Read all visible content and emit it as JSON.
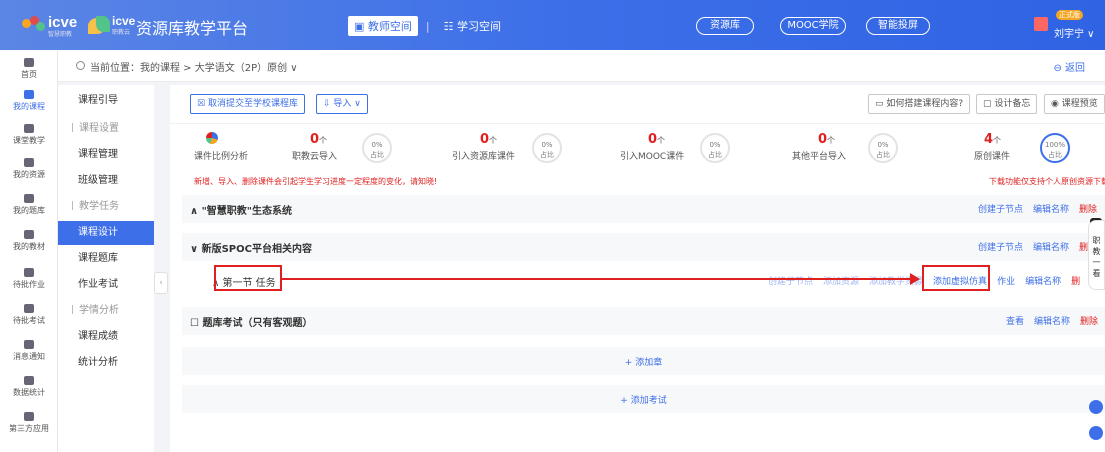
{
  "header": {
    "logo1": {
      "text": "icve",
      "sub": "智慧职教"
    },
    "logo2": {
      "text": "icve",
      "sub": "职教云"
    },
    "brand": "资源库教学平台",
    "tabs": [
      {
        "label": "教师空间",
        "active": true
      },
      {
        "label": "学习空间",
        "active": false
      }
    ],
    "pills": [
      "资源库",
      "MOOC学院",
      "智能投屏"
    ],
    "user": {
      "badge": "正式版",
      "name": "刘宇宁"
    }
  },
  "left_nav": [
    {
      "label": "首页",
      "icon": "home-icon"
    },
    {
      "label": "我的课程",
      "icon": "course-icon",
      "active": true
    },
    {
      "label": "课堂教学",
      "icon": "classroom-icon"
    },
    {
      "label": "我的资源",
      "icon": "resource-icon"
    },
    {
      "label": "我的题库",
      "icon": "question-bank-icon"
    },
    {
      "label": "我的教材",
      "icon": "textbook-icon"
    },
    {
      "label": "待批作业",
      "icon": "homework-icon"
    },
    {
      "label": "待批考试",
      "icon": "exam-icon"
    },
    {
      "label": "消息通知",
      "icon": "message-icon"
    },
    {
      "label": "数据统计",
      "icon": "statistics-icon"
    },
    {
      "label": "第三方应用",
      "icon": "apps-icon"
    }
  ],
  "breadcrumb": {
    "text": "当前位置：我的课程 > 大学语文（2P）原创 ∨",
    "back": "返回"
  },
  "side_nav": [
    {
      "label": "课程引导"
    },
    {
      "label": "课程设置",
      "group": true
    },
    {
      "label": "课程管理"
    },
    {
      "label": "班级管理"
    },
    {
      "label": "教学任务",
      "group": true
    },
    {
      "label": "课程设计",
      "active": true
    },
    {
      "label": "课程题库"
    },
    {
      "label": "作业考试"
    },
    {
      "label": "学情分析",
      "group": true
    },
    {
      "label": "课程成绩"
    },
    {
      "label": "统计分析"
    }
  ],
  "toolbar": {
    "cancel_submit": "取消提交至学校课程库",
    "import": "导入 ∨",
    "how_to": "如何搭建课程内容?",
    "design_notes": "设计备忘",
    "preview": "课程预览"
  },
  "stats": {
    "ratio_label": "课件比例分析",
    "items": [
      {
        "count": "0",
        "unit": "个",
        "label": "职教云导入",
        "pct": "0%",
        "pct_label": "占比"
      },
      {
        "count": "0",
        "unit": "个",
        "label": "引入资源库课件",
        "pct": "0%",
        "pct_label": "占比"
      },
      {
        "count": "0",
        "unit": "个",
        "label": "引入MOOC课件",
        "pct": "0%",
        "pct_label": "占比"
      },
      {
        "count": "0",
        "unit": "个",
        "label": "其他平台导入",
        "pct": "0%",
        "pct_label": "占比"
      },
      {
        "count": "4",
        "unit": "个",
        "label": "原创课件",
        "pct": "100%",
        "pct_label": "占比"
      }
    ]
  },
  "notice_left": "新增、导入、删除课件会引起学生学习进度一定程度的变化，请知晓!",
  "notice_right": "下载功能仅支持个人原创资源下载",
  "rows": {
    "r1": {
      "title": "∧ \"智慧职教\"生态系统",
      "acts": [
        "创建子节点",
        "编辑名称",
        "删除"
      ]
    },
    "r2": {
      "title": "∨ 新版SPOC平台相关内容",
      "acts": [
        "创建子节点",
        "编辑名称",
        "删"
      ]
    },
    "r3": {
      "title": "∧ 第一节 任务",
      "acts_faint": [
        "创建子节点",
        "添加资源",
        "添加教学资源"
      ],
      "acts": [
        "添加虚拟仿真",
        "作业",
        "编辑名称",
        "删"
      ]
    },
    "r4": {
      "title": "☐ 题库考试（只有客观题）",
      "acts": [
        "查看",
        "编辑名称",
        "删除"
      ]
    },
    "add_chapter": "+ 添加章",
    "add_exam": "+ 添加考试"
  },
  "float_panel": "职教一看",
  "colors": {
    "primary": "#3d6fe8",
    "danger": "#e02020"
  }
}
